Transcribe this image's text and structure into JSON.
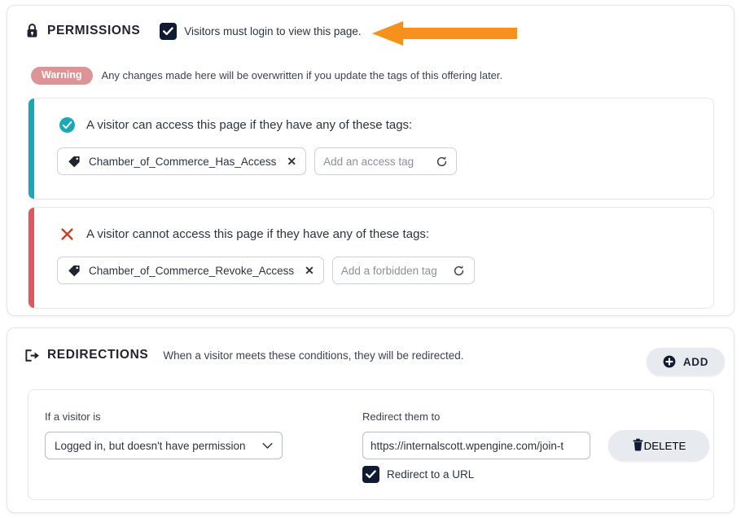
{
  "permissions": {
    "icon": "lock-icon",
    "title": "PERMISSIONS",
    "login_checkbox": {
      "label": "Visitors must login to view this page.",
      "checked": true
    },
    "warning": {
      "badge": "Warning",
      "badge_color": "#dd9497",
      "text": "Any changes made here will be overwritten if you update the tags of this offering later."
    },
    "allow_rule": {
      "icon": "check-circle-icon",
      "accent_color": "#18a8b8",
      "title": "A visitor can access this page if they have any of these tags:",
      "tags": [
        {
          "icon": "tag-icon",
          "label": "Chamber_of_Commerce_Has_Access",
          "remove": "✕"
        }
      ],
      "input_placeholder": "Add an access tag",
      "input_value": "",
      "refresh_icon": "refresh-icon"
    },
    "deny_rule": {
      "icon": "x-mark-icon",
      "accent_color": "#e0585d",
      "title": "A visitor cannot access this page if they have any of these tags:",
      "tags": [
        {
          "icon": "tag-icon",
          "label": "Chamber_of_Commerce_Revoke_Access",
          "remove": "✕"
        }
      ],
      "input_placeholder": "Add a forbidden tag",
      "input_value": "",
      "refresh_icon": "refresh-icon"
    }
  },
  "redirections": {
    "icon": "exit-arrow-icon",
    "title": "REDIRECTIONS",
    "description": "When a visitor meets these conditions, they will be redirected.",
    "add_button": {
      "icon": "plus-circle-icon",
      "label": "ADD"
    },
    "row": {
      "visitor_label": "If a visitor is",
      "visitor_select_value": "Logged in, but doesn't have permission",
      "visitor_select_chevron": "chevron-down-icon",
      "redirect_label": "Redirect them to",
      "redirect_url_value": "https://internalscott.wpengine.com/join-t",
      "redirect_url_placeholder": "",
      "redirect_checkbox": {
        "label": "Redirect to a URL",
        "checked": true
      },
      "delete_button": {
        "icon": "trash-icon",
        "label": "DELETE"
      }
    }
  },
  "annotation": {
    "arrow": "left-pointing-arrow",
    "color": "#f7911e"
  }
}
